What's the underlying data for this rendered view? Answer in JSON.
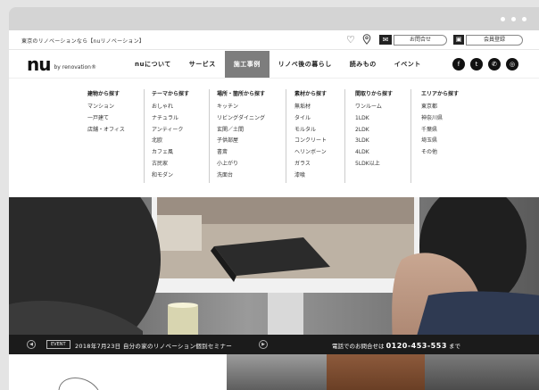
{
  "utility": {
    "tagline": "東京のリノベーションなら【nuリノベーション】",
    "contact_label": "お問合せ",
    "member_label": "会員登録"
  },
  "brand": {
    "logo": "nu",
    "sub": "by renovation®"
  },
  "nav": {
    "items": [
      {
        "label": "nuについて"
      },
      {
        "label": "サービス"
      },
      {
        "label": "施工事例",
        "active": true
      },
      {
        "label": "リノベ後の暮らし"
      },
      {
        "label": "読みもの"
      },
      {
        "label": "イベント"
      }
    ]
  },
  "social": [
    "facebook-icon",
    "twitter-icon",
    "line-icon",
    "instagram-icon"
  ],
  "mega_menu": {
    "columns": [
      {
        "head": "建物から探す",
        "links": [
          "マンション",
          "一戸建て",
          "店舗・オフィス"
        ]
      },
      {
        "head": "テーマから探す",
        "links": [
          "おしゃれ",
          "ナチュラル",
          "アンティーク",
          "北欧",
          "カフェ風",
          "古民家",
          "和モダン"
        ]
      },
      {
        "head": "場所・箇所から探す",
        "links": [
          "キッチン",
          "リビングダイニング",
          "玄関／土間",
          "子供部屋",
          "書斎",
          "小上がり",
          "洗面台"
        ]
      },
      {
        "head": "素材から探す",
        "links": [
          "無垢材",
          "タイル",
          "モルタル",
          "コンクリート",
          "ヘリンボーン",
          "ガラス",
          "漆喰"
        ]
      },
      {
        "head": "間取りから探す",
        "links": [
          "ワンルーム",
          "1LDK",
          "2LDK",
          "3LDK",
          "4LDK",
          "5LDK以上"
        ]
      },
      {
        "head": "エリアから探す",
        "links": [
          "東京都",
          "神奈川県",
          "千葉県",
          "埼玉県",
          "その他"
        ]
      }
    ]
  },
  "ticker": {
    "badge": "EVENT",
    "event_text": "2018年7月23日 自分の家のリノベーション個別セミナー",
    "phone_prefix": "電話でのお問合せは",
    "phone_number": "0120-453-553",
    "phone_suffix": "まで"
  },
  "colors": {
    "nav_active_bg": "#7d7d7d",
    "ticker_bg": "#1b1b1b"
  }
}
